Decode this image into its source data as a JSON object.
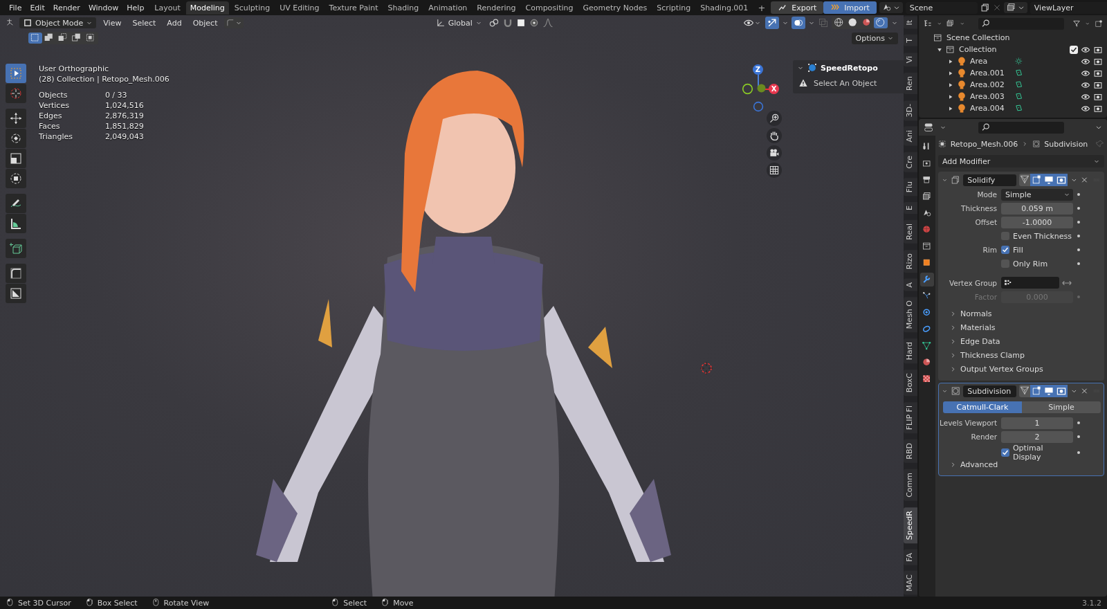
{
  "menu": [
    "File",
    "Edit",
    "Render",
    "Window",
    "Help"
  ],
  "workspaces": [
    {
      "label": "Layout",
      "selected": false
    },
    {
      "label": "Modeling",
      "selected": true
    },
    {
      "label": "Sculpting",
      "selected": false
    },
    {
      "label": "UV Editing",
      "selected": false
    },
    {
      "label": "Texture Paint",
      "selected": false
    },
    {
      "label": "Shading",
      "selected": false
    },
    {
      "label": "Animation",
      "selected": false
    },
    {
      "label": "Rendering",
      "selected": false
    },
    {
      "label": "Compositing",
      "selected": false
    },
    {
      "label": "Geometry Nodes",
      "selected": false
    },
    {
      "label": "Scripting",
      "selected": false
    },
    {
      "label": "Shading.001",
      "selected": false
    }
  ],
  "add_workspace": "+",
  "addon_buttons": [
    {
      "kind": "export",
      "label": "Export"
    },
    {
      "kind": "import",
      "label": "Import"
    }
  ],
  "scene": "Scene",
  "view_layer": "ViewLayer",
  "viewport_header": {
    "mode": "Object Mode",
    "menus": [
      "View",
      "Select",
      "Add",
      "Object"
    ],
    "orientation": "Global",
    "options": "Options",
    "shading": [
      {
        "kind": "wireframe",
        "selected": false
      },
      {
        "kind": "solid",
        "selected": false
      },
      {
        "kind": "material",
        "selected": false
      },
      {
        "kind": "rendered",
        "selected": true
      }
    ]
  },
  "select_modes": [
    {
      "kind": "new",
      "selected": true
    },
    {
      "kind": "extend",
      "selected": false
    },
    {
      "kind": "subtract",
      "selected": false
    },
    {
      "kind": "invert",
      "selected": false
    },
    {
      "kind": "intersect",
      "selected": false
    }
  ],
  "overlay": {
    "view_name": "User Orthographic",
    "collection": "(28) Collection | Retopo_Mesh.006",
    "stats": [
      {
        "label": "Objects",
        "value": "0 / 33"
      },
      {
        "label": "Vertices",
        "value": "1,024,516"
      },
      {
        "label": "Edges",
        "value": "2,876,319"
      },
      {
        "label": "Faces",
        "value": "1,851,829"
      },
      {
        "label": "Triangles",
        "value": "2,049,043"
      }
    ]
  },
  "tools": [
    {
      "kind": "select",
      "selected": true
    },
    {
      "kind": "cursor",
      "selected": false
    },
    {
      "kind": "move",
      "selected": false
    },
    {
      "kind": "rotate",
      "selected": false
    },
    {
      "kind": "scale",
      "selected": false
    },
    {
      "kind": "transform",
      "selected": false
    },
    {
      "kind": "annotate",
      "selected": false
    },
    {
      "kind": "measure",
      "selected": false
    },
    {
      "kind": "add-cube",
      "selected": false
    },
    {
      "kind": "bevel",
      "selected": false
    },
    {
      "kind": "shrink",
      "selected": false
    }
  ],
  "gizmo_axes": [
    "Z",
    "X"
  ],
  "npanel": {
    "title": "SpeedRetopo",
    "message": "Select An Object"
  },
  "side_tabs": [
    {
      "label": "It",
      "selected": false
    },
    {
      "label": "T",
      "selected": false
    },
    {
      "label": "Vi",
      "selected": false
    },
    {
      "label": "Ren",
      "selected": false
    },
    {
      "label": "3D-",
      "selected": false
    },
    {
      "label": "Ani",
      "selected": false
    },
    {
      "label": "Cre",
      "selected": false
    },
    {
      "label": "Flu",
      "selected": false
    },
    {
      "label": "E",
      "selected": false
    },
    {
      "label": "Real",
      "selected": false
    },
    {
      "label": "Rizo",
      "selected": false
    },
    {
      "label": "A",
      "selected": false
    },
    {
      "label": "Mesh O",
      "selected": false
    },
    {
      "label": "Hard",
      "selected": false
    },
    {
      "label": "BoxC",
      "selected": false
    },
    {
      "label": "FLIP Fl",
      "selected": false
    },
    {
      "label": "RBD",
      "selected": false
    },
    {
      "label": "Comm",
      "selected": false
    },
    {
      "label": "SpeedR",
      "selected": true
    },
    {
      "label": "FA",
      "selected": false
    },
    {
      "label": "MAC",
      "selected": false
    }
  ],
  "outliner": {
    "root": "Scene Collection",
    "collection": {
      "name": "Collection",
      "checked": true
    },
    "items": [
      {
        "name": "Area",
        "kind": "sun"
      },
      {
        "name": "Area.001",
        "kind": "area"
      },
      {
        "name": "Area.002",
        "kind": "area"
      },
      {
        "name": "Area.003",
        "kind": "area"
      },
      {
        "name": "Area.004",
        "kind": "area"
      }
    ]
  },
  "prop_tabs": [
    {
      "kind": "tool",
      "selected": false
    },
    {
      "kind": "render",
      "selected": false
    },
    {
      "kind": "output",
      "selected": false
    },
    {
      "kind": "view-layer",
      "selected": false
    },
    {
      "kind": "scene",
      "selected": false
    },
    {
      "kind": "world",
      "selected": false
    },
    {
      "kind": "collection",
      "selected": false
    },
    {
      "kind": "object",
      "selected": false
    },
    {
      "kind": "modifier",
      "selected": true
    },
    {
      "kind": "particles",
      "selected": false
    },
    {
      "kind": "physics",
      "selected": false
    },
    {
      "kind": "constraints",
      "selected": false
    },
    {
      "kind": "data",
      "selected": false
    },
    {
      "kind": "material",
      "selected": false
    },
    {
      "kind": "texture",
      "selected": false
    }
  ],
  "properties": {
    "object": "Retopo_Mesh.006",
    "modifier": "Subdivision",
    "add_modifier": "Add Modifier",
    "modifiers": [
      {
        "kind": "solidify",
        "name": "Solidify",
        "active": false,
        "rows": [
          {
            "kind": "dropdown",
            "label": "Mode",
            "value": "Simple"
          },
          {
            "kind": "number",
            "label": "Thickness",
            "value": "0.059 m",
            "disabled": false
          },
          {
            "kind": "number",
            "label": "Offset",
            "value": "-1.0000",
            "disabled": false
          },
          {
            "kind": "checkbox",
            "text": "Even Thickness",
            "checked": false
          },
          {
            "kind": "checkbox",
            "label": "Rim",
            "text": "Fill",
            "checked": true
          },
          {
            "kind": "checkbox",
            "text": "Only Rim",
            "checked": false
          },
          {
            "kind": "vgroup",
            "label": "Vertex Group"
          },
          {
            "kind": "number",
            "label": "Factor",
            "value": "0.000",
            "disabled": true
          }
        ],
        "subpanels": [
          "Normals",
          "Materials",
          "Edge Data",
          "Thickness Clamp",
          "Output Vertex Groups"
        ]
      },
      {
        "kind": "subdivision",
        "name": "Subdivision",
        "active": true,
        "rows": [
          {
            "kind": "segmented",
            "options": [
              {
                "label": "Catmull-Clark",
                "selected": true
              },
              {
                "label": "Simple",
                "selected": false
              }
            ]
          },
          {
            "kind": "number",
            "label": "Levels Viewport",
            "value": "1",
            "disabled": false
          },
          {
            "kind": "number",
            "label": "Render",
            "value": "2",
            "disabled": false
          },
          {
            "kind": "checkbox",
            "text": "Optimal Display",
            "checked": true
          }
        ],
        "subpanels": [
          "Advanced"
        ]
      }
    ]
  },
  "status": [
    {
      "kind": "left",
      "label": "Set 3D Cursor"
    },
    {
      "kind": "drag",
      "label": "Box Select"
    },
    {
      "kind": "middle",
      "label": "Rotate View"
    },
    {
      "kind": "left",
      "label": "Select"
    },
    {
      "kind": "drag",
      "label": "Move"
    }
  ],
  "version": "3.1.2"
}
